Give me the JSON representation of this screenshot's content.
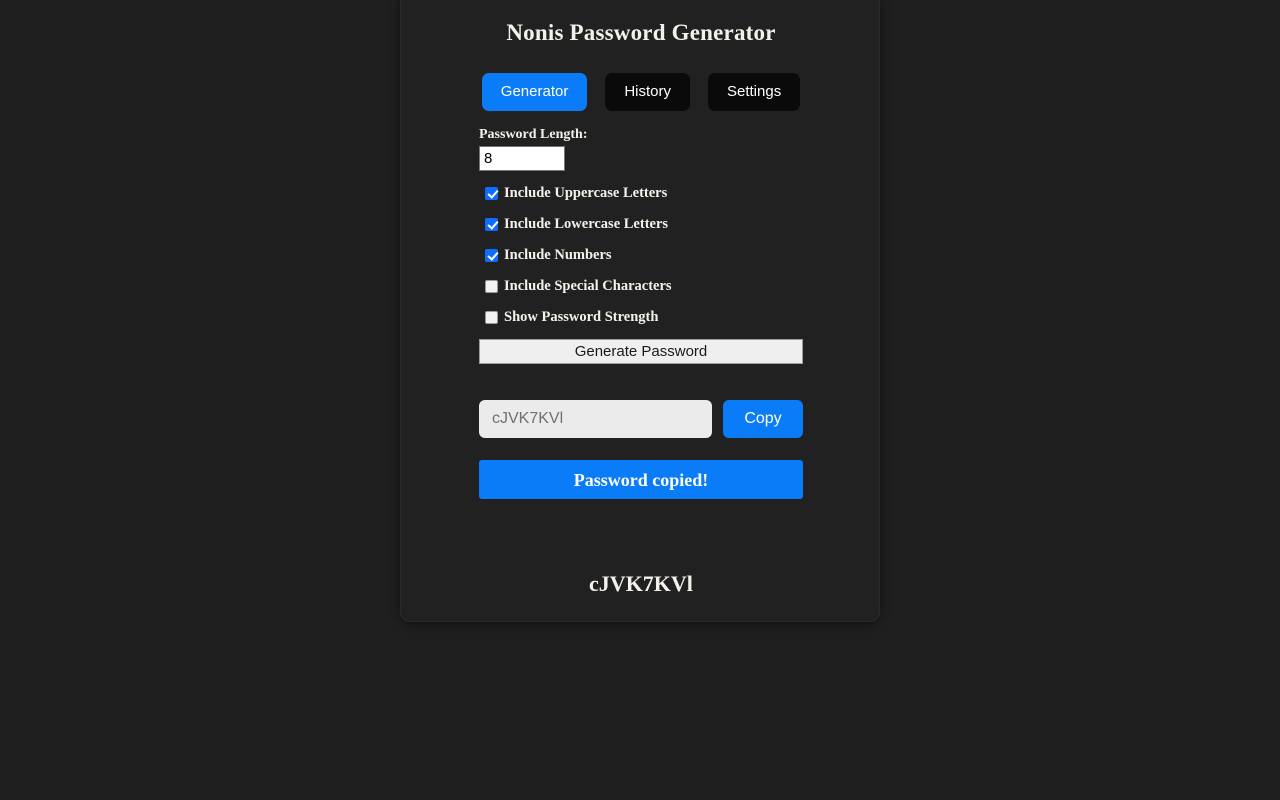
{
  "app": {
    "title": "Nonis Password Generator"
  },
  "tabs": [
    {
      "label": "Generator",
      "active": true
    },
    {
      "label": "History",
      "active": false
    },
    {
      "label": "Settings",
      "active": false
    }
  ],
  "form": {
    "length_label": "Password Length:",
    "length_value": "8",
    "length_placeholder": "",
    "options": [
      {
        "label": "Include Uppercase Letters",
        "checked": true
      },
      {
        "label": "Include Lowercase Letters",
        "checked": true
      },
      {
        "label": "Include Numbers",
        "checked": true
      },
      {
        "label": "Include Special Characters",
        "checked": false
      },
      {
        "label": "Show Password Strength",
        "checked": false
      }
    ],
    "generate_label": "Generate Password"
  },
  "output": {
    "password_value": "cJVK7KVl",
    "password_placeholder": "cJVK7KVl",
    "copy_label": "Copy",
    "status_message": "Password copied!",
    "generated_password": "cJVK7KVl"
  },
  "colors": {
    "accent": "#0b7cf7",
    "page_background": "#1f1f1f",
    "card_background": "#212121",
    "text": "#f4f1ea",
    "checkbox_checked": "#0d6efd"
  }
}
